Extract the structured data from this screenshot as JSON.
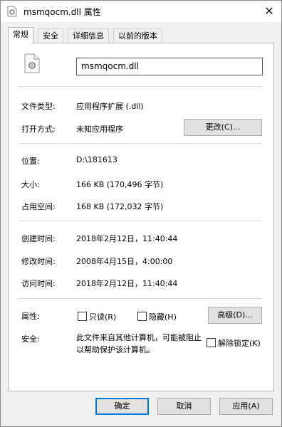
{
  "window": {
    "title": "msmqocm.dll 属性",
    "close_glyph": "✕"
  },
  "tabs": [
    {
      "label": "常规",
      "active": true
    },
    {
      "label": "安全"
    },
    {
      "label": "详细信息"
    },
    {
      "label": "以前的版本"
    }
  ],
  "general": {
    "file_icon": "dll-gear-file-icon",
    "file_name": "msmqocm.dll",
    "file_type": {
      "label": "文件类型:",
      "value": "应用程序扩展 (.dll)"
    },
    "opens_with": {
      "label": "打开方式:",
      "value": "未知应用程序",
      "change_button": "更改(C)..."
    },
    "location": {
      "label": "位置:",
      "value": "D:\\181613"
    },
    "size": {
      "label": "大小:",
      "value": "166 KB (170,496 字节)"
    },
    "size_on_disk": {
      "label": "占用空间:",
      "value": "168 KB (172,032 字节)"
    },
    "created": {
      "label": "创建时间:",
      "value": "2018年2月12日，11:40:44"
    },
    "modified": {
      "label": "修改时间:",
      "value": "2008年4月15日，4:00:00"
    },
    "accessed": {
      "label": "访问时间:",
      "value": "2018年2月12日，11:40:44"
    },
    "attributes": {
      "label": "属性:",
      "readonly": {
        "label": "只读(R)",
        "checked": false
      },
      "hidden": {
        "label": "隐藏(H)",
        "checked": false
      },
      "advanced_button": "高级(D)..."
    },
    "security": {
      "label": "安全:",
      "text": "此文件来自其他计算机，可能被阻止以帮助保护该计算机。",
      "unblock": {
        "label": "解除锁定(K)",
        "checked": false
      }
    }
  },
  "buttons": {
    "ok": "确定",
    "cancel": "取消",
    "apply": "应用(A)"
  }
}
